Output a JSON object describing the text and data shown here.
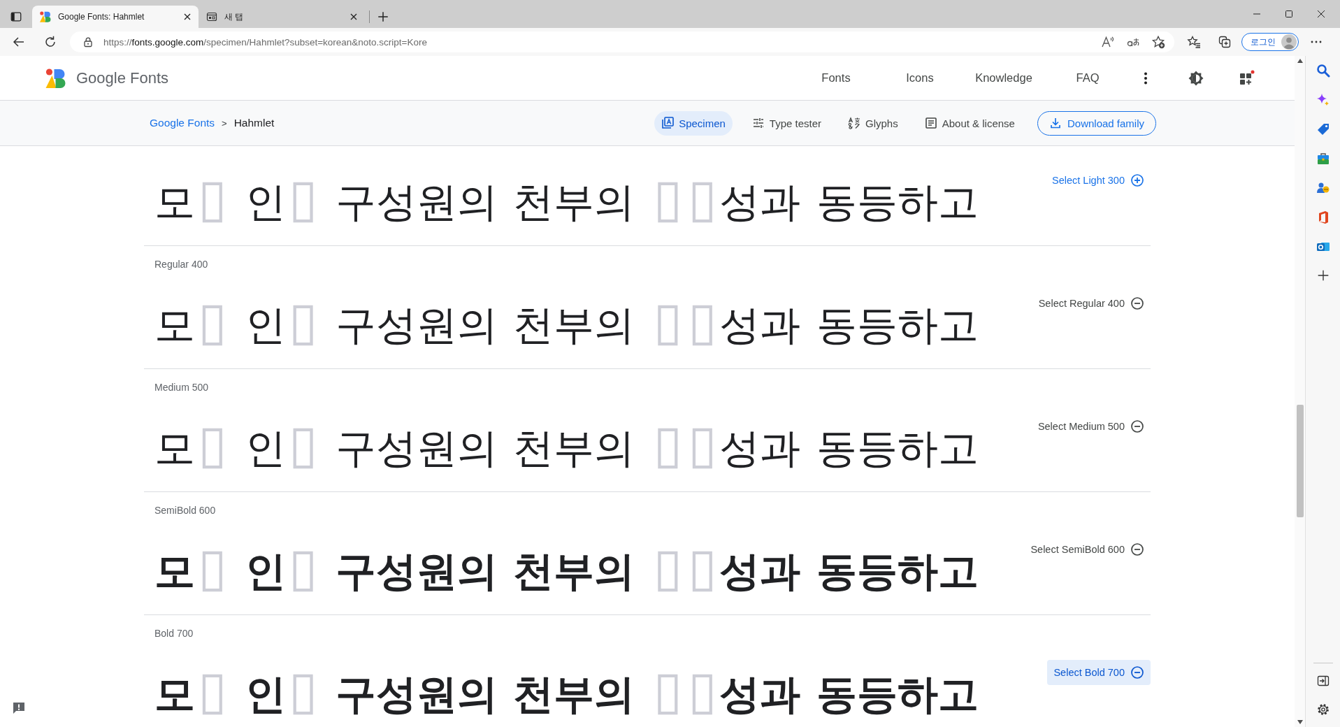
{
  "browser": {
    "tabs": [
      {
        "title": "Google Fonts: Hahmlet",
        "selected": true
      },
      {
        "title": "새 탭",
        "selected": false
      }
    ],
    "address": {
      "scheme": "https://",
      "host": "fonts.google.com",
      "path": "/specimen/Hahmlet?subset=korean&noto.script=Kore"
    },
    "sign_in": "로그인"
  },
  "header": {
    "brand": "Google Fonts",
    "nav": [
      "Fonts",
      "Icons",
      "Knowledge",
      "FAQ"
    ]
  },
  "breadcrumb": {
    "link": "Google Fonts",
    "separator": ">",
    "current": "Hahmlet"
  },
  "page_tabs": [
    {
      "label": "Specimen",
      "selected": true
    },
    {
      "label": "Type tester",
      "selected": false
    },
    {
      "label": "Glyphs",
      "selected": false
    },
    {
      "label": "About & license",
      "selected": false
    }
  ],
  "download_button": "Download family",
  "styles": [
    {
      "select": "Select Light 300",
      "selected": false,
      "hovered": false,
      "sample": [
        {
          "text": "모",
          "missing": false
        },
        {
          "text": "▯",
          "missing": true
        },
        {
          "text": " 인",
          "missing": false
        },
        {
          "text": "▯",
          "missing": true
        },
        {
          "text": " 구성원의 천부의 ",
          "missing": false
        },
        {
          "text": "▯",
          "missing": true
        },
        {
          "text": "▯",
          "missing": true
        },
        {
          "text": "성과 동등하고",
          "missing": false
        }
      ]
    },
    {
      "label": "Regular 400",
      "select": "Select Regular 400",
      "selected": true,
      "hovered": false,
      "sample": [
        {
          "text": "모",
          "missing": false
        },
        {
          "text": "▯",
          "missing": true
        },
        {
          "text": " 인",
          "missing": false
        },
        {
          "text": "▯",
          "missing": true
        },
        {
          "text": " 구성원의 천부의 ",
          "missing": false
        },
        {
          "text": "▯",
          "missing": true
        },
        {
          "text": "▯",
          "missing": true
        },
        {
          "text": "성과 동등하고",
          "missing": false
        }
      ]
    },
    {
      "label": "Medium 500",
      "select": "Select Medium 500",
      "selected": true,
      "hovered": false,
      "sample": [
        {
          "text": "모",
          "missing": false
        },
        {
          "text": "▯",
          "missing": true
        },
        {
          "text": " 인",
          "missing": false
        },
        {
          "text": "▯",
          "missing": true
        },
        {
          "text": " 구성원의 천부의 ",
          "missing": false
        },
        {
          "text": "▯",
          "missing": true
        },
        {
          "text": "▯",
          "missing": true
        },
        {
          "text": "성과 동등하고",
          "missing": false
        }
      ]
    },
    {
      "label": "SemiBold 600",
      "select": "Select SemiBold 600",
      "selected": true,
      "hovered": false,
      "sample": [
        {
          "text": "모",
          "missing": false
        },
        {
          "text": "▯",
          "missing": true
        },
        {
          "text": " 인",
          "missing": false
        },
        {
          "text": "▯",
          "missing": true
        },
        {
          "text": " 구성원의 천부의 ",
          "missing": false
        },
        {
          "text": "▯",
          "missing": true
        },
        {
          "text": "▯",
          "missing": true
        },
        {
          "text": "성과 동등하고",
          "missing": false
        }
      ]
    },
    {
      "label": "Bold 700",
      "select": "Select Bold 700",
      "selected": true,
      "hovered": true,
      "sample": [
        {
          "text": "모",
          "missing": false
        },
        {
          "text": "▯",
          "missing": true
        },
        {
          "text": " 인",
          "missing": false
        },
        {
          "text": "▯",
          "missing": true
        },
        {
          "text": " 구성원의 천부의 ",
          "missing": false
        },
        {
          "text": "▯",
          "missing": true
        },
        {
          "text": "▯",
          "missing": true
        },
        {
          "text": "성과 동등하고",
          "missing": false
        }
      ]
    }
  ]
}
